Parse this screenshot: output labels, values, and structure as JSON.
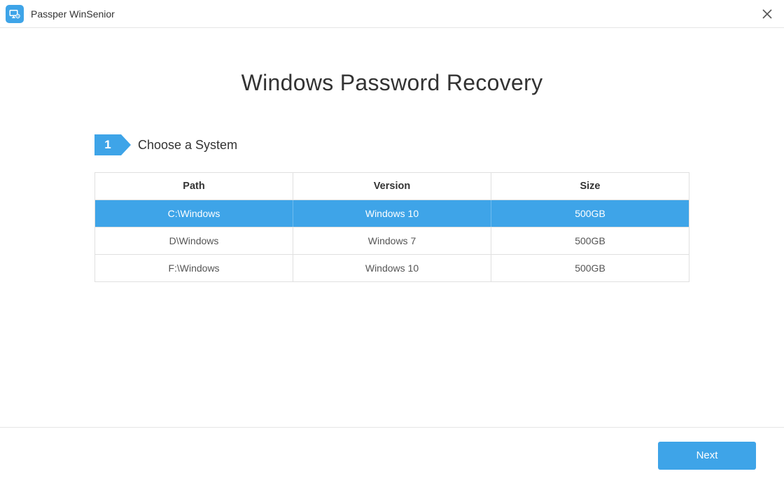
{
  "app": {
    "title": "Passper WinSenior"
  },
  "page": {
    "title": "Windows Password Recovery"
  },
  "step": {
    "number": "1",
    "label": "Choose a System"
  },
  "table": {
    "headers": {
      "path": "Path",
      "version": "Version",
      "size": "Size"
    },
    "rows": [
      {
        "path": "C:\\Windows",
        "version": "Windows 10",
        "size": "500GB",
        "selected": true
      },
      {
        "path": "D\\Windows",
        "version": "Windows 7",
        "size": "500GB",
        "selected": false
      },
      {
        "path": "F:\\Windows",
        "version": "Windows 10",
        "size": "500GB",
        "selected": false
      }
    ]
  },
  "footer": {
    "next_label": "Next"
  }
}
